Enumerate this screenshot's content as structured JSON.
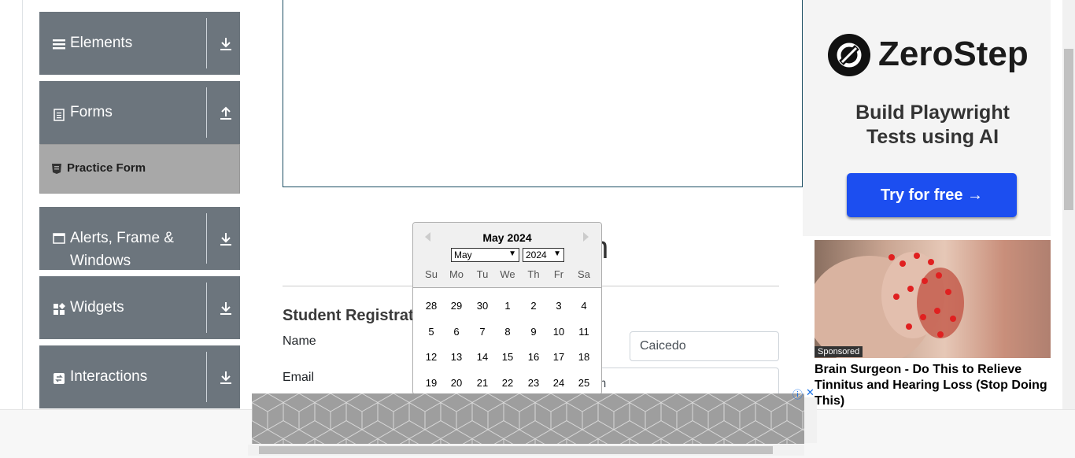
{
  "sidebar": {
    "groups": [
      {
        "label": "Elements",
        "icon": "hamburger-icon",
        "action": "download-icon"
      },
      {
        "label": "Forms",
        "icon": "form-icon",
        "action": "upload-icon"
      },
      {
        "label": "Alerts, Frame &",
        "label2": "Windows",
        "icon": "window-icon",
        "action": "download-icon"
      },
      {
        "label": "Widgets",
        "icon": "widgets-icon",
        "action": "download-icon"
      },
      {
        "label": "Interactions",
        "icon": "interactions-icon",
        "action": "download-icon"
      }
    ],
    "active_item": {
      "label": "Practice Form",
      "icon": "html5-icon"
    }
  },
  "main": {
    "heading_fragment": "m",
    "subtitle": "Student Registratic",
    "fields": {
      "name_label": "Name",
      "last_name_value": "Caicedo",
      "email_label": "Email",
      "email_value_fragment": "m"
    }
  },
  "datepicker": {
    "title": "May 2024",
    "month_select": "May",
    "year_select": "2024",
    "weekdays": [
      "Su",
      "Mo",
      "Tu",
      "We",
      "Th",
      "Fr",
      "Sa"
    ],
    "weeks": [
      [
        "28",
        "29",
        "30",
        "1",
        "2",
        "3",
        "4"
      ],
      [
        "5",
        "6",
        "7",
        "8",
        "9",
        "10",
        "11"
      ],
      [
        "12",
        "13",
        "14",
        "15",
        "16",
        "17",
        "18"
      ],
      [
        "19",
        "20",
        "21",
        "22",
        "23",
        "24",
        "25"
      ]
    ]
  },
  "ad": {
    "brand": "ZeroStep",
    "tagline_1": "Build Playwright",
    "tagline_2": "Tests using AI",
    "cta": "Try for free →",
    "sponsored": "Sponsored",
    "headline": "Brain Surgeon - Do This to Relieve Tinnitus and Hearing Loss (Stop Doing This)",
    "info_icon": "ⓘ",
    "close_icon": "✕"
  },
  "colors": {
    "sidebar_group": "#6c757d",
    "active_item": "#a8a8a8",
    "cta_blue": "#1c4ef0"
  }
}
